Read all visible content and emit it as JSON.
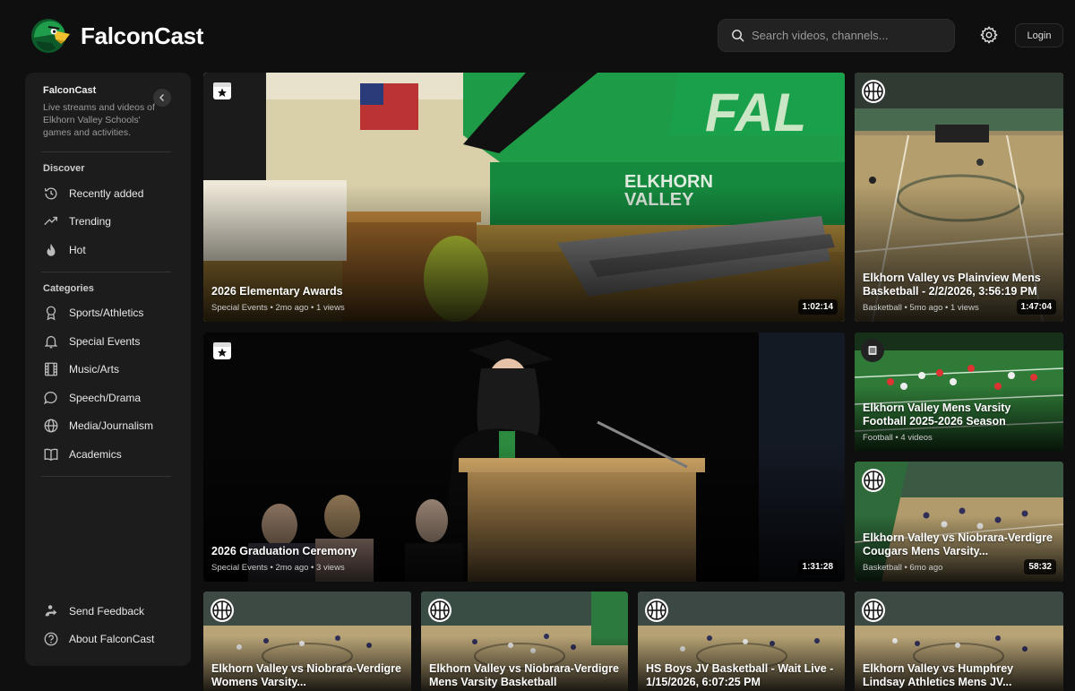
{
  "app": {
    "name": "FalconCast"
  },
  "header": {
    "search_placeholder": "Search videos, channels...",
    "login_label": "Login"
  },
  "sidebar": {
    "title": "FalconCast",
    "description": "Live streams and videos of Elkhorn Valley Schools' games and activities.",
    "discover_heading": "Discover",
    "discover": [
      {
        "label": "Recently added",
        "icon": "clock-history-icon"
      },
      {
        "label": "Trending",
        "icon": "trending-icon"
      },
      {
        "label": "Hot",
        "icon": "flame-icon"
      }
    ],
    "categories_heading": "Categories",
    "categories": [
      {
        "label": "Sports/Athletics",
        "icon": "medal-icon"
      },
      {
        "label": "Special Events",
        "icon": "bell-icon"
      },
      {
        "label": "Music/Arts",
        "icon": "film-icon"
      },
      {
        "label": "Speech/Drama",
        "icon": "speech-bubble-icon"
      },
      {
        "label": "Media/Journalism",
        "icon": "globe-icon"
      },
      {
        "label": "Academics",
        "icon": "book-icon"
      }
    ],
    "footer": [
      {
        "label": "Send Feedback",
        "icon": "feedback-icon"
      },
      {
        "label": "About FalconCast",
        "icon": "question-icon"
      }
    ]
  },
  "videos": [
    {
      "title": "2026 Elementary Awards",
      "meta": "Special Events • 2mo ago • 1 views",
      "duration": "1:02:14",
      "icon": "calendar-star-icon"
    },
    {
      "title": "Elkhorn Valley vs Plainview Mens Basketball - 2/2/2026, 3:56:19 PM",
      "meta": "Basketball • 5mo ago • 1 views",
      "duration": "1:47:04",
      "icon": "basketball-icon"
    },
    {
      "title": "2026 Graduation Ceremony",
      "meta": "Special Events • 2mo ago • 3 views",
      "duration": "1:31:28",
      "icon": "calendar-star-icon"
    },
    {
      "title": "Elkhorn Valley Mens Varsity Football 2025-2026 Season",
      "meta": "Football • 4 videos",
      "duration": "",
      "icon": "playlist-icon"
    },
    {
      "title": "Elkhorn Valley vs Niobrara-Verdigre Cougars Mens Varsity...",
      "meta": "Basketball • 6mo ago",
      "duration": "58:32",
      "icon": "basketball-icon"
    },
    {
      "title": "Elkhorn Valley vs Niobrara-Verdigre Womens Varsity...",
      "meta": "",
      "duration": "",
      "icon": "basketball-icon"
    },
    {
      "title": "Elkhorn Valley vs Niobrara-Verdigre Mens Varsity Basketball",
      "meta": "",
      "duration": "",
      "icon": "basketball-icon"
    },
    {
      "title": "HS Boys JV Basketball - Wait Live - 1/15/2026, 6:07:25 PM",
      "meta": "",
      "duration": "",
      "icon": "basketball-icon"
    },
    {
      "title": "Elkhorn Valley vs Humphrey Lindsay Athletics Mens JV...",
      "meta": "",
      "duration": "",
      "icon": "basketball-icon"
    }
  ],
  "colors": {
    "brand_green": "#1f9d4a",
    "background": "#0f0f0f",
    "panel": "#1c1c1c"
  }
}
